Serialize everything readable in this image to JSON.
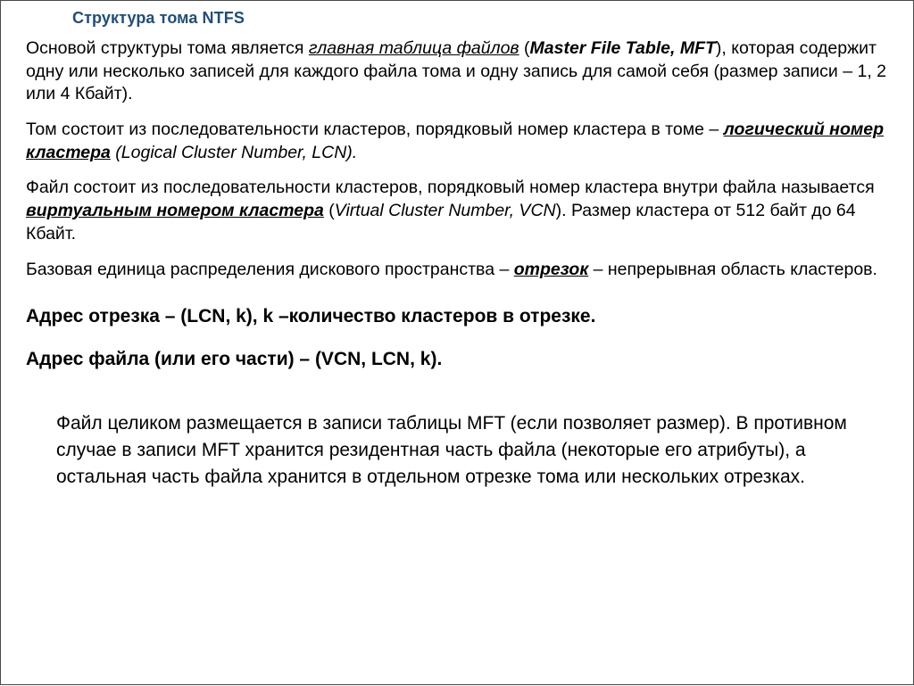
{
  "slide": {
    "title": "Структура тома NTFS",
    "title_color": "#1F4E79",
    "background_color": "#FFFFFF",
    "text_color": "#000000",
    "border_color": "#4A4A4A"
  },
  "paragraphs": {
    "p1": {
      "seg1": "Основой структуры тома является ",
      "term_ru": "главная таблица файлов",
      "seg2": " (",
      "term_en": "Master File Table, MFT",
      "seg3": "), которая содержит одну или несколько записей для каждого файла тома и одну запись для самой себя (размер записи – 1, 2 или 4 Кбайт)."
    },
    "p2": {
      "seg1": "Том состоит из последовательности кластеров, порядковый номер кластера в томе – ",
      "term_ru": "логический номер кластера",
      "seg2": " ",
      "term_en": "(Logical Cluster Number, LCN).",
      "seg3": ""
    },
    "p3": {
      "seg1": "Файл состоит из последовательности кластеров, порядковый номер кластера внутри файла называется ",
      "term_ru": "виртуальным номером кластера",
      "seg2": " (",
      "term_en": "Virtual Cluster Number, VCN",
      "seg3": "). Размер кластера от 512 байт до 64 Кбайт."
    },
    "p4": {
      "seg1": "Базовая единица распределения дискового пространства – ",
      "term_ru": "отрезок",
      "seg2": " – непрерывная область кластеров.",
      "term_en": "",
      "seg3": ""
    }
  },
  "headings": {
    "line1": "Адрес отрезка – (LCN, k), k –количество кластеров в отрезке.",
    "line2": "Адрес файла (или его части) – (VCN, LCN, k)."
  },
  "final_paragraph": {
    "text": "Файл целиком размещается в записи таблицы MFT (если позволяет размер). В противном случае в записи MFT хранится резидентная часть файла (некоторые его атрибуты), а остальная часть файла хранится в отдельном отрезке тома или нескольких отрезках."
  }
}
